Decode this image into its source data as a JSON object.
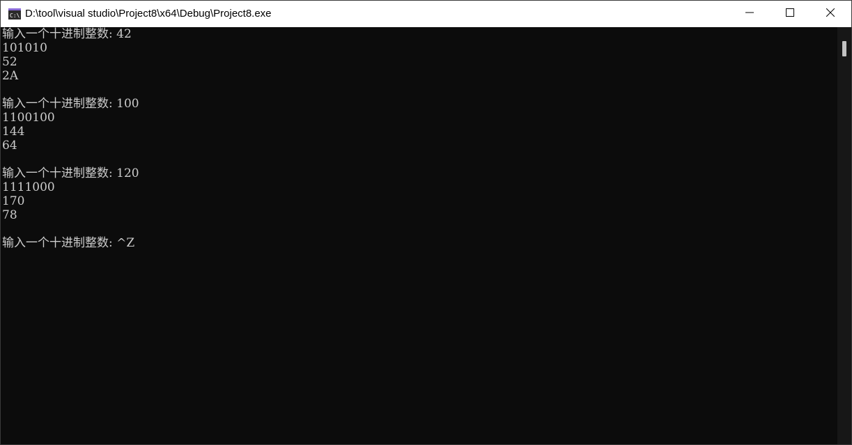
{
  "window": {
    "title": "D:\\tool\\visual studio\\Project8\\x64\\Debug\\Project8.exe",
    "app_icon": "console-app-icon",
    "controls": {
      "minimize_icon": "minimize-icon",
      "maximize_icon": "maximize-icon",
      "close_icon": "close-icon"
    }
  },
  "console": {
    "lines": [
      "输入一个十进制整数: 42",
      "101010",
      "52",
      "2A",
      "",
      "输入一个十进制整数: 100",
      "1100100",
      "144",
      "64",
      "",
      "输入一个十进制整数: 120",
      "1111000",
      "170",
      "78",
      "",
      "输入一个十进制整数: ^Z"
    ]
  },
  "colors": {
    "console_background": "#0c0c0c",
    "console_text": "#cccccc",
    "titlebar_background": "#ffffff",
    "scroll_thumb": "#c2c2c2"
  }
}
